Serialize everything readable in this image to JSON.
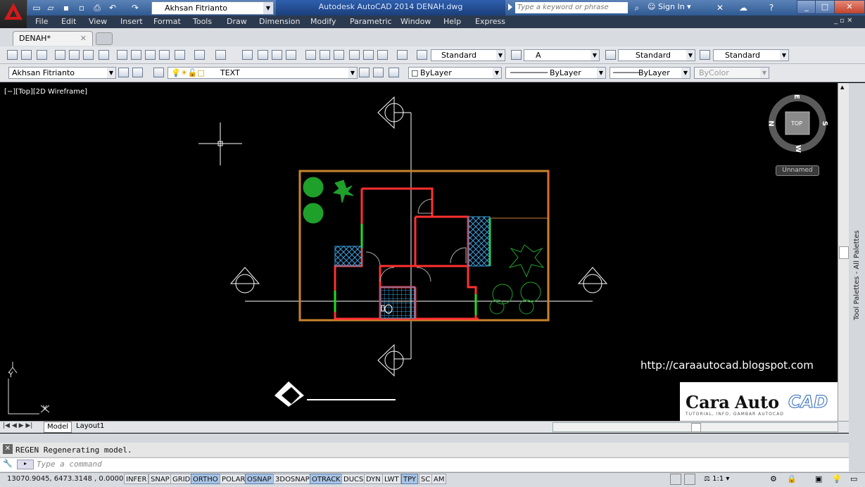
{
  "window": {
    "title": "Autodesk AutoCAD 2014   DENAH.dwg",
    "workspace": "Akhsan Fitrianto",
    "search_placeholder": "Type a keyword or phrase",
    "sign_in": "Sign In",
    "help": "?"
  },
  "menu": [
    "File",
    "Edit",
    "View",
    "Insert",
    "Format",
    "Tools",
    "Draw",
    "Dimension",
    "Modify",
    "Parametric",
    "Window",
    "Help",
    "Express"
  ],
  "document_tab": {
    "label": "DENAH*"
  },
  "toolbar1": {
    "text_style": "Standard",
    "annotative_scale": "A",
    "dim_style": "Standard",
    "table_style": "Standard"
  },
  "toolbar2": {
    "workspace": "Akhsan Fitrianto",
    "layer": "TEXT",
    "color": "ByLayer",
    "linetype": "ByLayer",
    "lineweight": "ByLayer",
    "plotstyle": "ByColor"
  },
  "viewport": {
    "label": "[−][Top][2D Wireframe]",
    "viewcube_face": "TOP",
    "compass": {
      "n": "N",
      "s": "S",
      "e": "E",
      "w": "W"
    },
    "ucs_name": "Unnamed",
    "ucs_x": "X",
    "ucs_y": "Y"
  },
  "watermark": {
    "url": "http://caraautocad.blogspot.com",
    "brand_cara": "Cara",
    "brand_auto": "Auto",
    "brand_cad": "CAD",
    "brand_sub": "TUTORIAL, INFO, GAMBAR AUTOCAD"
  },
  "layout_tabs": [
    "Model",
    "Layout1"
  ],
  "palette_label": "Tool Palettes - All Palettes",
  "command": {
    "history": "REGEN Regenerating model.",
    "placeholder": "Type a command"
  },
  "status": {
    "coords": "13070.9045, 6473.3148 , 0.0000",
    "toggles": [
      {
        "label": "INFER",
        "on": false
      },
      {
        "label": "SNAP",
        "on": false
      },
      {
        "label": "GRID",
        "on": false
      },
      {
        "label": "ORTHO",
        "on": true
      },
      {
        "label": "POLAR",
        "on": false
      },
      {
        "label": "OSNAP",
        "on": true
      },
      {
        "label": "3DOSNAP",
        "on": false
      },
      {
        "label": "OTRACK",
        "on": true
      },
      {
        "label": "DUCS",
        "on": false
      },
      {
        "label": "DYN",
        "on": false
      },
      {
        "label": "LWT",
        "on": false
      },
      {
        "label": "TPY",
        "on": true
      },
      {
        "label": "SC",
        "on": false
      },
      {
        "label": "AM",
        "on": false
      }
    ],
    "annotation_scale": "1:1"
  },
  "colors": {
    "titlebar": "#3a68a6",
    "canvas": "#000000",
    "wall_red": "#ff3030",
    "site_orange": "#c8842c",
    "hatch_blue": "#3aa0e0",
    "plant_green": "#1fa02a",
    "door_green": "#22dd22"
  }
}
